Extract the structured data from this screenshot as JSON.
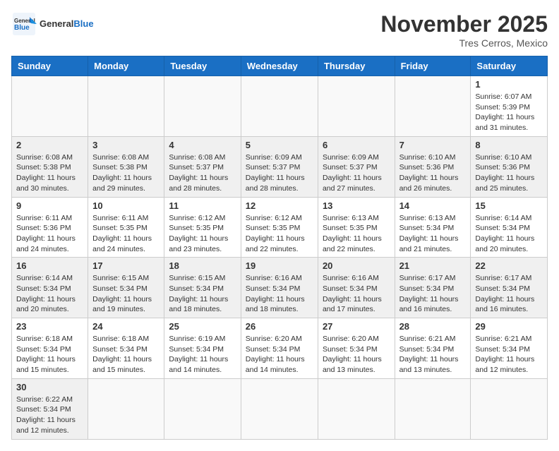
{
  "header": {
    "logo_general": "General",
    "logo_blue": "Blue",
    "month_title": "November 2025",
    "location": "Tres Cerros, Mexico"
  },
  "weekdays": [
    "Sunday",
    "Monday",
    "Tuesday",
    "Wednesday",
    "Thursday",
    "Friday",
    "Saturday"
  ],
  "weeks": [
    [
      {
        "day": "",
        "info": ""
      },
      {
        "day": "",
        "info": ""
      },
      {
        "day": "",
        "info": ""
      },
      {
        "day": "",
        "info": ""
      },
      {
        "day": "",
        "info": ""
      },
      {
        "day": "",
        "info": ""
      },
      {
        "day": "1",
        "info": "Sunrise: 6:07 AM\nSunset: 5:39 PM\nDaylight: 11 hours and 31 minutes."
      }
    ],
    [
      {
        "day": "2",
        "info": "Sunrise: 6:08 AM\nSunset: 5:38 PM\nDaylight: 11 hours and 30 minutes."
      },
      {
        "day": "3",
        "info": "Sunrise: 6:08 AM\nSunset: 5:38 PM\nDaylight: 11 hours and 29 minutes."
      },
      {
        "day": "4",
        "info": "Sunrise: 6:08 AM\nSunset: 5:37 PM\nDaylight: 11 hours and 28 minutes."
      },
      {
        "day": "5",
        "info": "Sunrise: 6:09 AM\nSunset: 5:37 PM\nDaylight: 11 hours and 28 minutes."
      },
      {
        "day": "6",
        "info": "Sunrise: 6:09 AM\nSunset: 5:37 PM\nDaylight: 11 hours and 27 minutes."
      },
      {
        "day": "7",
        "info": "Sunrise: 6:10 AM\nSunset: 5:36 PM\nDaylight: 11 hours and 26 minutes."
      },
      {
        "day": "8",
        "info": "Sunrise: 6:10 AM\nSunset: 5:36 PM\nDaylight: 11 hours and 25 minutes."
      }
    ],
    [
      {
        "day": "9",
        "info": "Sunrise: 6:11 AM\nSunset: 5:36 PM\nDaylight: 11 hours and 24 minutes."
      },
      {
        "day": "10",
        "info": "Sunrise: 6:11 AM\nSunset: 5:35 PM\nDaylight: 11 hours and 24 minutes."
      },
      {
        "day": "11",
        "info": "Sunrise: 6:12 AM\nSunset: 5:35 PM\nDaylight: 11 hours and 23 minutes."
      },
      {
        "day": "12",
        "info": "Sunrise: 6:12 AM\nSunset: 5:35 PM\nDaylight: 11 hours and 22 minutes."
      },
      {
        "day": "13",
        "info": "Sunrise: 6:13 AM\nSunset: 5:35 PM\nDaylight: 11 hours and 22 minutes."
      },
      {
        "day": "14",
        "info": "Sunrise: 6:13 AM\nSunset: 5:34 PM\nDaylight: 11 hours and 21 minutes."
      },
      {
        "day": "15",
        "info": "Sunrise: 6:14 AM\nSunset: 5:34 PM\nDaylight: 11 hours and 20 minutes."
      }
    ],
    [
      {
        "day": "16",
        "info": "Sunrise: 6:14 AM\nSunset: 5:34 PM\nDaylight: 11 hours and 20 minutes."
      },
      {
        "day": "17",
        "info": "Sunrise: 6:15 AM\nSunset: 5:34 PM\nDaylight: 11 hours and 19 minutes."
      },
      {
        "day": "18",
        "info": "Sunrise: 6:15 AM\nSunset: 5:34 PM\nDaylight: 11 hours and 18 minutes."
      },
      {
        "day": "19",
        "info": "Sunrise: 6:16 AM\nSunset: 5:34 PM\nDaylight: 11 hours and 18 minutes."
      },
      {
        "day": "20",
        "info": "Sunrise: 6:16 AM\nSunset: 5:34 PM\nDaylight: 11 hours and 17 minutes."
      },
      {
        "day": "21",
        "info": "Sunrise: 6:17 AM\nSunset: 5:34 PM\nDaylight: 11 hours and 16 minutes."
      },
      {
        "day": "22",
        "info": "Sunrise: 6:17 AM\nSunset: 5:34 PM\nDaylight: 11 hours and 16 minutes."
      }
    ],
    [
      {
        "day": "23",
        "info": "Sunrise: 6:18 AM\nSunset: 5:34 PM\nDaylight: 11 hours and 15 minutes."
      },
      {
        "day": "24",
        "info": "Sunrise: 6:18 AM\nSunset: 5:34 PM\nDaylight: 11 hours and 15 minutes."
      },
      {
        "day": "25",
        "info": "Sunrise: 6:19 AM\nSunset: 5:34 PM\nDaylight: 11 hours and 14 minutes."
      },
      {
        "day": "26",
        "info": "Sunrise: 6:20 AM\nSunset: 5:34 PM\nDaylight: 11 hours and 14 minutes."
      },
      {
        "day": "27",
        "info": "Sunrise: 6:20 AM\nSunset: 5:34 PM\nDaylight: 11 hours and 13 minutes."
      },
      {
        "day": "28",
        "info": "Sunrise: 6:21 AM\nSunset: 5:34 PM\nDaylight: 11 hours and 13 minutes."
      },
      {
        "day": "29",
        "info": "Sunrise: 6:21 AM\nSunset: 5:34 PM\nDaylight: 11 hours and 12 minutes."
      }
    ],
    [
      {
        "day": "30",
        "info": "Sunrise: 6:22 AM\nSunset: 5:34 PM\nDaylight: 11 hours and 12 minutes."
      },
      {
        "day": "",
        "info": ""
      },
      {
        "day": "",
        "info": ""
      },
      {
        "day": "",
        "info": ""
      },
      {
        "day": "",
        "info": ""
      },
      {
        "day": "",
        "info": ""
      },
      {
        "day": "",
        "info": ""
      }
    ]
  ]
}
